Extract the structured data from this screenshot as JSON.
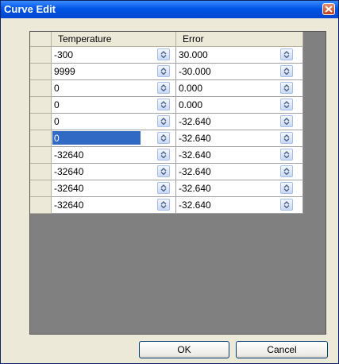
{
  "window": {
    "title": "Curve Edit"
  },
  "grid": {
    "columns": [
      "Temperature",
      "Error"
    ],
    "rows": [
      {
        "temperature": "-300",
        "error": "30.000"
      },
      {
        "temperature": "9999",
        "error": "-30.000"
      },
      {
        "temperature": "0",
        "error": "0.000"
      },
      {
        "temperature": "0",
        "error": "0.000"
      },
      {
        "temperature": "0",
        "error": "-32.640"
      },
      {
        "temperature": "0",
        "error": "-32.640",
        "selected": true
      },
      {
        "temperature": "-32640",
        "error": "-32.640"
      },
      {
        "temperature": "-32640",
        "error": "-32.640"
      },
      {
        "temperature": "-32640",
        "error": "-32.640"
      },
      {
        "temperature": "-32640",
        "error": "-32.640"
      }
    ]
  },
  "buttons": {
    "ok": "OK",
    "cancel": "Cancel"
  },
  "icons": {
    "spinner": "spin-up-down-icon",
    "close": "close-icon"
  },
  "colors": {
    "titlebar": "#0055e5",
    "selection": "#316ac5",
    "grid_background": "#808080"
  }
}
